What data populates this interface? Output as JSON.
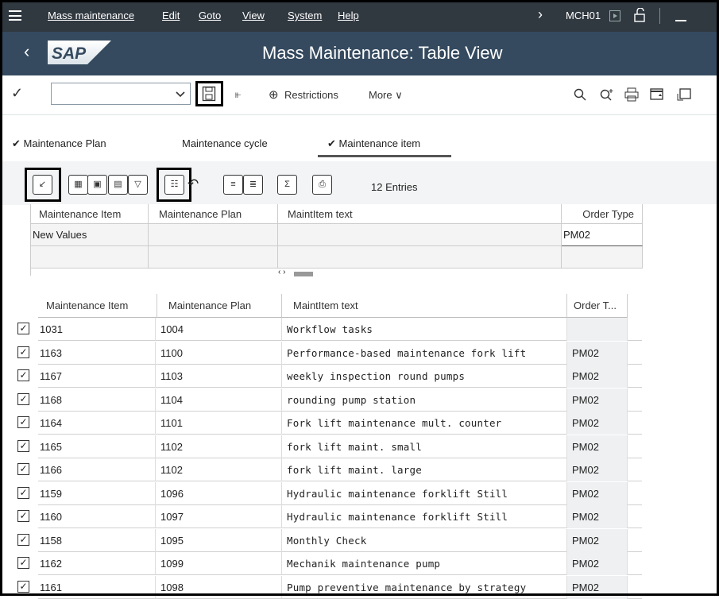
{
  "menubar": {
    "items": [
      "Mass maintenance",
      "Edit",
      "Goto",
      "View",
      "System",
      "Help"
    ],
    "transaction": "MCH01"
  },
  "titlebar": {
    "brand": "SAP",
    "title": "Mass Maintenance: Table View"
  },
  "toolbar": {
    "restrictions_label": "Restrictions",
    "more_label": "More"
  },
  "tabs": [
    {
      "label": "Maintenance Plan",
      "checked": true
    },
    {
      "label": "Maintenance cycle",
      "checked": false
    },
    {
      "label": "Maintenance item",
      "checked": true,
      "active": true
    }
  ],
  "upper": {
    "entries_label": "12 Entries",
    "columns": [
      "Maintenance Item",
      "Maintenance Plan",
      "MaintItem text",
      "Order Type"
    ],
    "new_values_label": "New Values",
    "new_order_type": "PM02"
  },
  "lower": {
    "columns": [
      "Maintenance Item",
      "Maintenance Plan",
      "MaintItem text",
      "Order T..."
    ],
    "rows": [
      {
        "item": "1031",
        "plan": "1004",
        "text": "Workflow tasks",
        "order_type": ""
      },
      {
        "item": "1163",
        "plan": "1100",
        "text": "Performance-based maintenance fork lift",
        "order_type": "PM02"
      },
      {
        "item": "1167",
        "plan": "1103",
        "text": "weekly inspection round pumps",
        "order_type": "PM02"
      },
      {
        "item": "1168",
        "plan": "1104",
        "text": "rounding pump station",
        "order_type": "PM02"
      },
      {
        "item": "1164",
        "plan": "1101",
        "text": "Fork lift maintenance mult. counter",
        "order_type": "PM02"
      },
      {
        "item": "1165",
        "plan": "1102",
        "text": "fork lift maint. small",
        "order_type": "PM02"
      },
      {
        "item": "1166",
        "plan": "1102",
        "text": "fork lift maint. large",
        "order_type": "PM02"
      },
      {
        "item": "1159",
        "plan": "1096",
        "text": "Hydraulic maintenance forklift Still",
        "order_type": "PM02"
      },
      {
        "item": "1160",
        "plan": "1097",
        "text": "Hydraulic maintenance forklift Still",
        "order_type": "PM02"
      },
      {
        "item": "1158",
        "plan": "1095",
        "text": "Monthly Check",
        "order_type": "PM02"
      },
      {
        "item": "1162",
        "plan": "1099",
        "text": "Mechanik maintenance pump",
        "order_type": "PM02"
      },
      {
        "item": "1161",
        "plan": "1098",
        "text": "Pump preventive maintenance by strategy",
        "order_type": "PM02"
      }
    ]
  }
}
